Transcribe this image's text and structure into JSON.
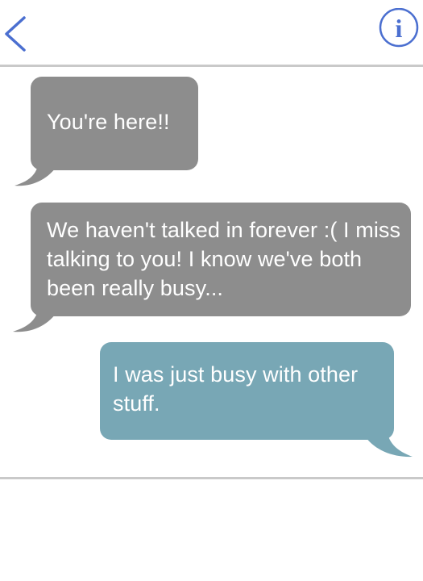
{
  "header": {
    "back_icon": "chevron-left-icon",
    "info_icon": "info-circle-icon",
    "info_glyph": "i"
  },
  "colors": {
    "accent": "#4b6fd0",
    "received_bubble": "#8d8d8d",
    "sent_bubble": "#78a7b5",
    "divider": "#c9c9c9"
  },
  "messages": [
    {
      "sender": "them",
      "text": "You're here!!"
    },
    {
      "sender": "them",
      "text": "We haven't talked in forever :( I miss talking to you! I know we've both been really busy..."
    },
    {
      "sender": "me",
      "text": "I was just busy with other stuff."
    }
  ]
}
